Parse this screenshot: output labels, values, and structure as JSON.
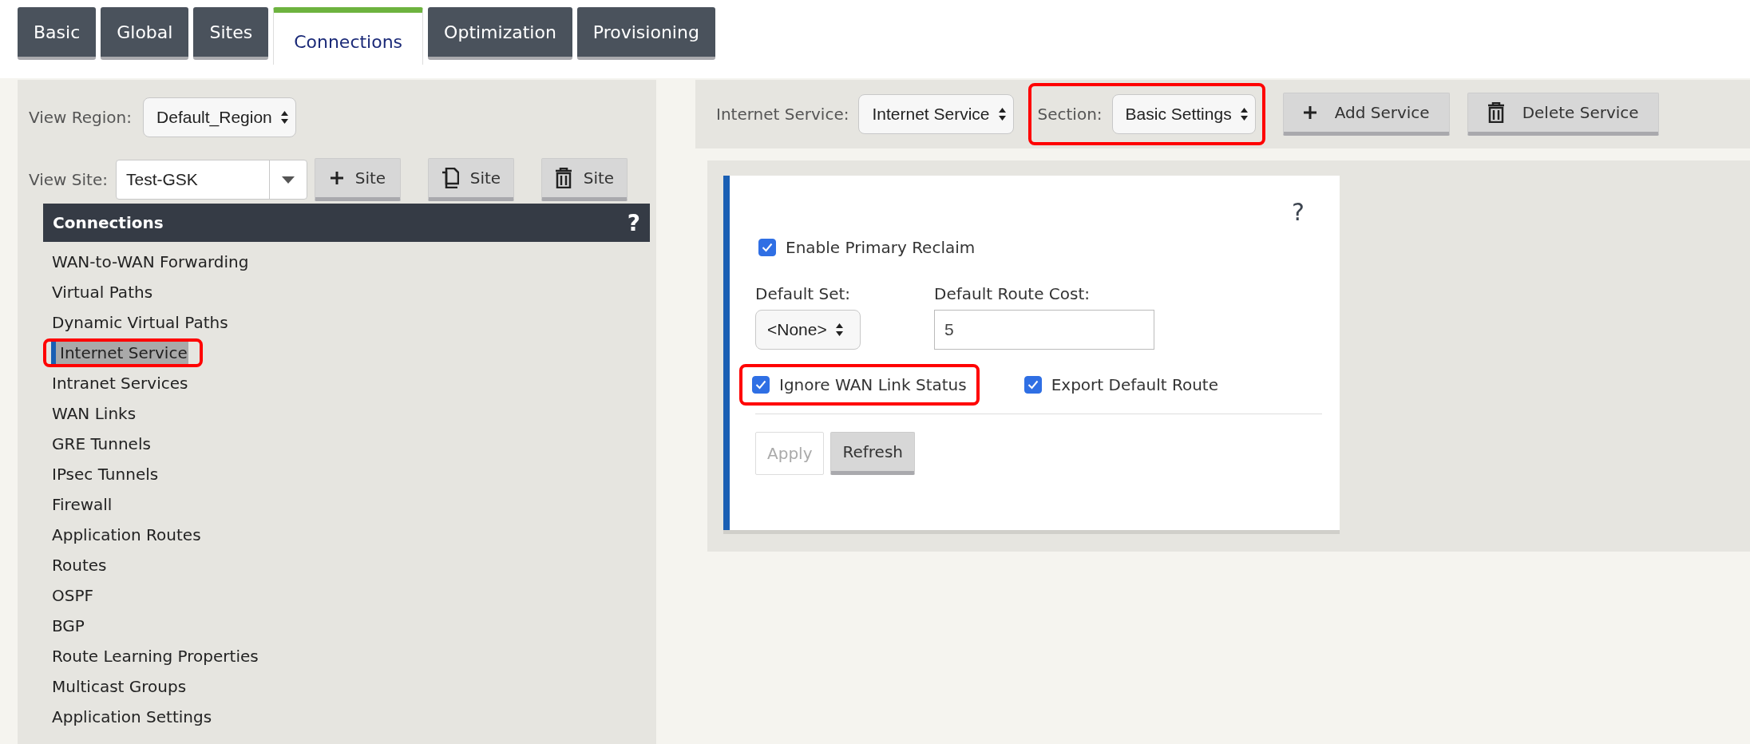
{
  "tabs": [
    {
      "label": "Basic",
      "selected": false
    },
    {
      "label": "Global",
      "selected": false
    },
    {
      "label": "Sites",
      "selected": false
    },
    {
      "label": "Connections",
      "selected": true
    },
    {
      "label": "Optimization",
      "selected": false
    },
    {
      "label": "Provisioning",
      "selected": false
    }
  ],
  "left_panel": {
    "region": {
      "label": "View Region:",
      "value": "Default_Region"
    },
    "site": {
      "label": "View Site:",
      "value": "Test-GSK",
      "buttons": [
        {
          "kind": "plus",
          "label": "Site"
        },
        {
          "kind": "copy",
          "label": "Site"
        },
        {
          "kind": "trash",
          "label": "Site"
        }
      ]
    },
    "nav": {
      "title": "Connections",
      "help": "?",
      "items": [
        {
          "label": "WAN-to-WAN Forwarding",
          "selected": false,
          "highlighted": false
        },
        {
          "label": "Virtual Paths",
          "selected": false,
          "highlighted": false
        },
        {
          "label": "Dynamic Virtual Paths",
          "selected": false,
          "highlighted": false
        },
        {
          "label": "Internet Service",
          "selected": true,
          "highlighted": true
        },
        {
          "label": "Intranet Services",
          "selected": false,
          "highlighted": false
        },
        {
          "label": "WAN Links",
          "selected": false,
          "highlighted": false
        },
        {
          "label": "GRE Tunnels",
          "selected": false,
          "highlighted": false
        },
        {
          "label": "IPsec Tunnels",
          "selected": false,
          "highlighted": false
        },
        {
          "label": "Firewall",
          "selected": false,
          "highlighted": false
        },
        {
          "label": "Application Routes",
          "selected": false,
          "highlighted": false
        },
        {
          "label": "Routes",
          "selected": false,
          "highlighted": false
        },
        {
          "label": "OSPF",
          "selected": false,
          "highlighted": false
        },
        {
          "label": "BGP",
          "selected": false,
          "highlighted": false
        },
        {
          "label": "Route Learning Properties",
          "selected": false,
          "highlighted": false
        },
        {
          "label": "Multicast Groups",
          "selected": false,
          "highlighted": false
        },
        {
          "label": "Application Settings",
          "selected": false,
          "highlighted": false
        }
      ]
    }
  },
  "toolbar": {
    "service": {
      "label": "Internet Service:",
      "value": "Internet Service"
    },
    "section": {
      "label": "Section:",
      "value": "Basic Settings",
      "highlighted": true
    },
    "buttons": [
      {
        "kind": "plus",
        "label": "Add Service"
      },
      {
        "kind": "trash",
        "label": "Delete Service"
      }
    ]
  },
  "form": {
    "help": "?",
    "enable_primary_reclaim": {
      "label": "Enable Primary Reclaim",
      "checked": true
    },
    "default_set": {
      "label": "Default Set:",
      "value": "<None>"
    },
    "default_route_cost": {
      "label": "Default Route Cost:",
      "value": "5"
    },
    "checkboxes": [
      {
        "label": "Ignore WAN Link Status",
        "checked": true,
        "highlighted": true
      },
      {
        "label": "Export Default Route",
        "checked": true,
        "highlighted": false
      }
    ],
    "actions": [
      {
        "label": "Apply",
        "disabled": true
      },
      {
        "label": "Refresh",
        "disabled": false
      }
    ]
  }
}
